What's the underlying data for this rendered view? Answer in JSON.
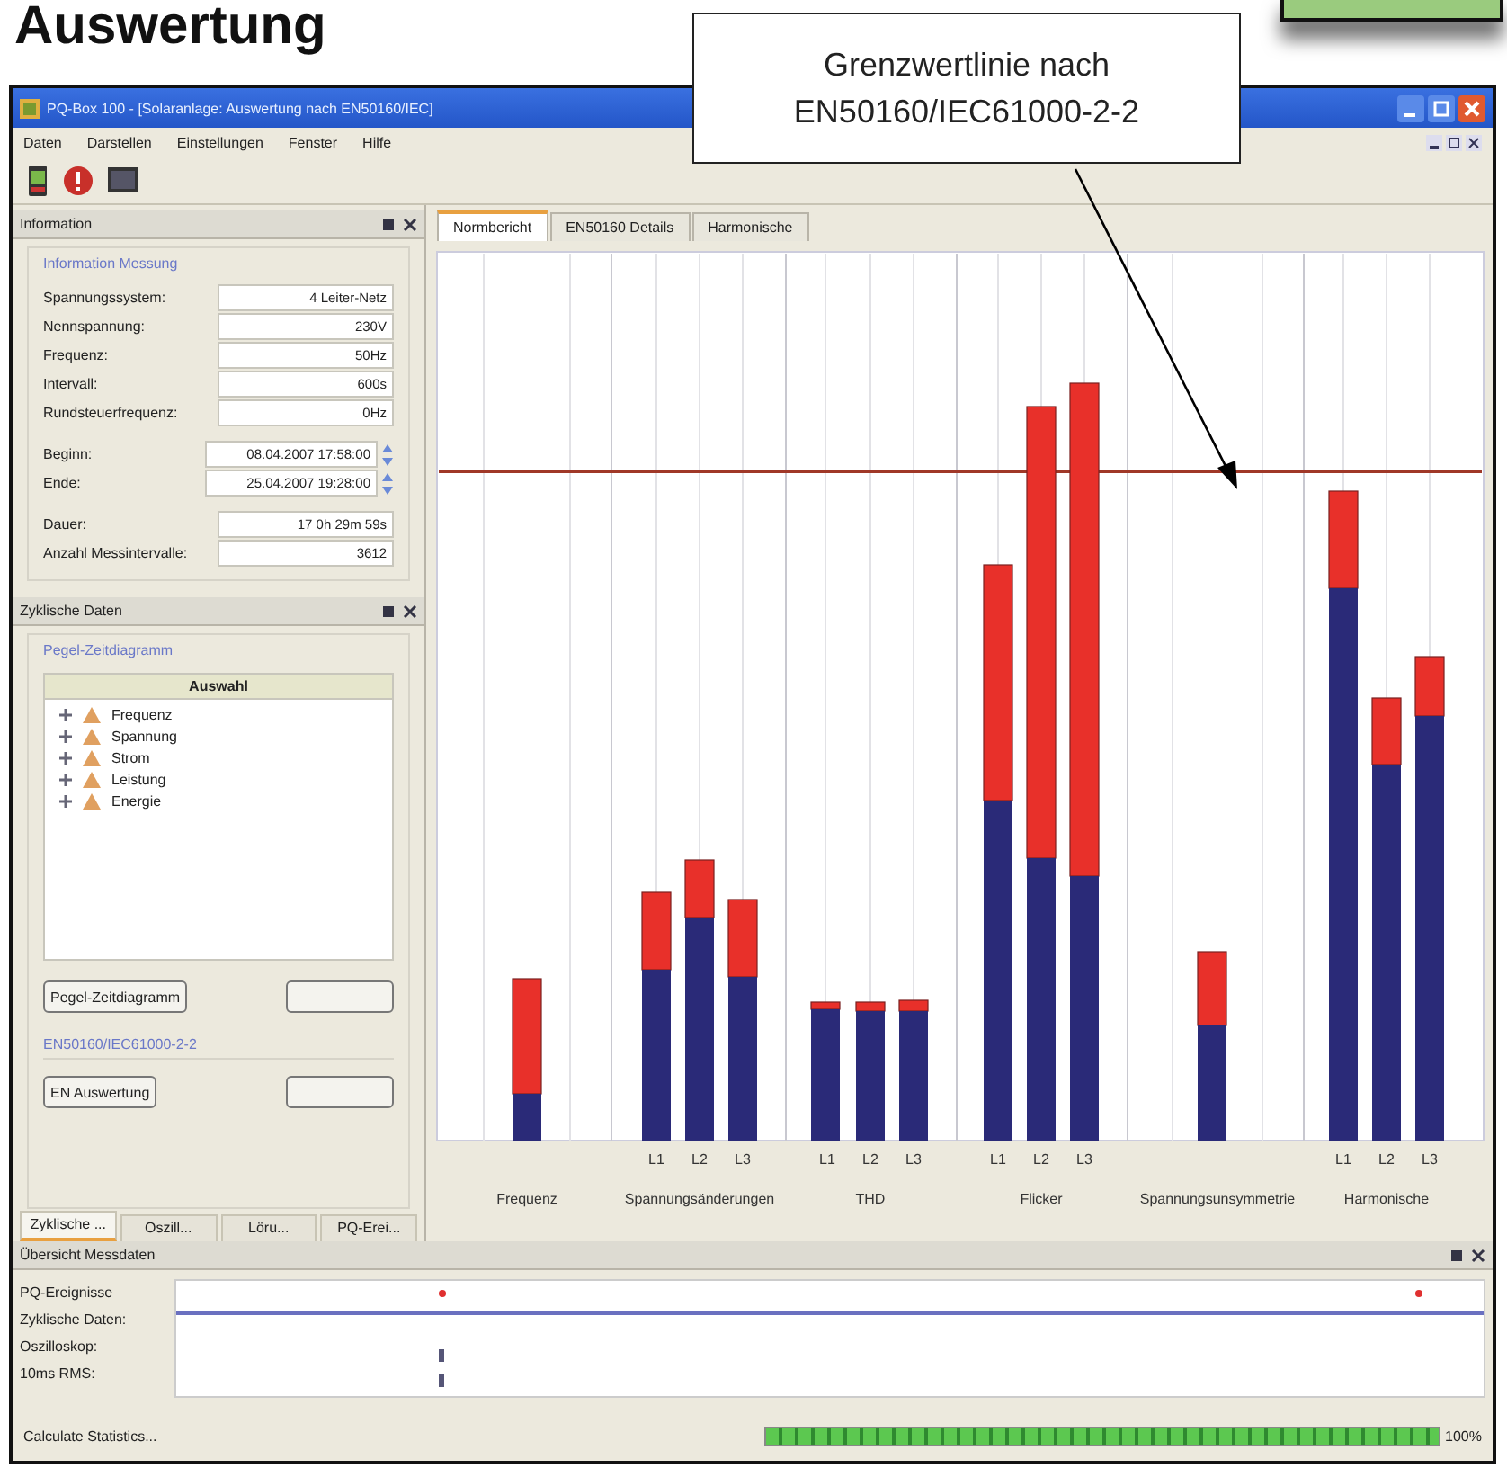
{
  "heading": "Auswertung",
  "callout": {
    "lines": [
      "Grenzwertlinie nach",
      "EN50160/IEC61000-2-2"
    ]
  },
  "window": {
    "title": "PQ-Box 100 - [Solaranlage: Auswertung nach EN50160/IEC]"
  },
  "menu": [
    "Daten",
    "Darstellen",
    "Einstellungen",
    "Fenster",
    "Hilfe"
  ],
  "information_panel": {
    "title": "Information",
    "group": "Information Messung",
    "fields": [
      {
        "label": "Spannungssystem:",
        "value": "4 Leiter-Netz",
        "kind": "text"
      },
      {
        "label": "Nennspannung:",
        "value": "230V",
        "kind": "text"
      },
      {
        "label": "Frequenz:",
        "value": "50Hz",
        "kind": "text"
      },
      {
        "label": "Intervall:",
        "value": "600s",
        "kind": "text"
      },
      {
        "label": "Rundsteuerfrequenz:",
        "value": "0Hz",
        "kind": "text"
      },
      {
        "label": "Beginn:",
        "value": "08.04.2007 17:58:00",
        "kind": "spin"
      },
      {
        "label": "Ende:",
        "value": "25.04.2007 19:28:00",
        "kind": "spin"
      },
      {
        "label": "Dauer:",
        "value": "17 0h 29m 59s",
        "kind": "text"
      },
      {
        "label": "Anzahl Messintervalle:",
        "value": "3612",
        "kind": "text"
      }
    ]
  },
  "cyclic_panel": {
    "title": "Zyklische Daten",
    "group": "Pegel-Zeitdiagramm",
    "tree_header": "Auswahl",
    "tree": [
      {
        "label": "Frequenz",
        "expanded": false
      },
      {
        "label": "Spannung",
        "expanded": false
      },
      {
        "label": "Strom",
        "expanded": false
      },
      {
        "label": "Leistung",
        "expanded": false
      },
      {
        "label": "Energie",
        "expanded": false
      }
    ],
    "button": "Pegel-Zeitdiagramm",
    "link": "EN50160/IEC61000-2-2",
    "en_button": "EN Auswertung"
  },
  "bottom_tabs": [
    {
      "label": "Zyklische ...",
      "selected": true
    },
    {
      "label": "Oszill...",
      "selected": false
    },
    {
      "label": "Löru...",
      "selected": false
    },
    {
      "label": "PQ-Erei...",
      "selected": false
    }
  ],
  "tabs": [
    {
      "label": "Normbericht",
      "selected": true
    },
    {
      "label": "EN50160 Details",
      "selected": false
    },
    {
      "label": "Harmonische",
      "selected": false
    }
  ],
  "chart": {
    "groups": [
      {
        "label": "Frequenz"
      },
      {
        "label": "Spannungsänderungen",
        "phases": [
          "L1",
          "L2",
          "L3"
        ]
      },
      {
        "label": "THD",
        "phases": [
          "L1",
          "L2",
          "L3"
        ]
      },
      {
        "label": "Flicker",
        "phases": [
          "L1",
          "L2",
          "L3"
        ]
      },
      {
        "label": "Spannungsunsymmetrie"
      },
      {
        "label": "Harmonische",
        "phases": [
          "L1",
          "L2",
          "L3"
        ]
      }
    ]
  },
  "overview": {
    "title": "Übersicht Messdaten",
    "rows": [
      "PQ-Ereignisse",
      "Zyklische Daten:",
      "Oszilloskop:",
      "10ms RMS:"
    ]
  },
  "status": {
    "text": "Calculate Statistics...",
    "level": 1,
    "reading": "100%"
  }
}
